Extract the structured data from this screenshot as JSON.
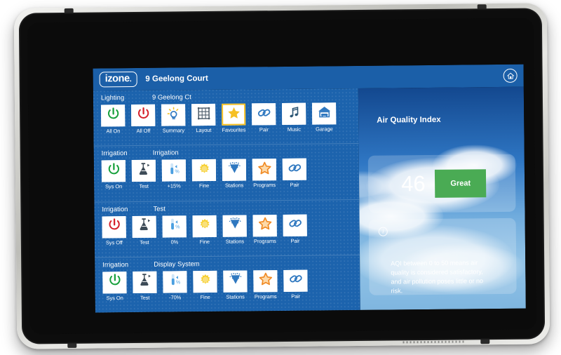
{
  "header": {
    "logo_text": "izone",
    "logo_dot": ".",
    "title": "9 Geelong Court",
    "home_icon": "home-circle-icon"
  },
  "rows": [
    {
      "type": "Lighting",
      "name": "9 Geelong Ct",
      "tiles": [
        {
          "label": "All On",
          "icon": "power-icon",
          "color": "#17a03c",
          "selected": false
        },
        {
          "label": "All Off",
          "icon": "power-icon",
          "color": "#d5202a",
          "selected": false
        },
        {
          "label": "Summary",
          "icon": "lightbulb-icon",
          "color": "#2f78c0",
          "selected": false
        },
        {
          "label": "Layout",
          "icon": "grid-icon",
          "color": "#4a5a68",
          "selected": false
        },
        {
          "label": "Favourites",
          "icon": "star-icon",
          "color": "#f6c024",
          "selected": true
        },
        {
          "label": "Pair",
          "icon": "link-icon",
          "color": "#2f78c0",
          "selected": false
        },
        {
          "label": "Music",
          "icon": "music-note-icon",
          "color": "#2b5574",
          "selected": false
        },
        {
          "label": "Garage",
          "icon": "garage-icon",
          "color": "#2f78c0",
          "selected": false
        }
      ]
    },
    {
      "type": "Irrigation",
      "name": "Irrigation",
      "tiles": [
        {
          "label": "Sys On",
          "icon": "power-icon",
          "color": "#17a03c",
          "selected": false
        },
        {
          "label": "Test",
          "icon": "flask-play-icon",
          "color": "#3d4b57",
          "selected": false
        },
        {
          "label": "+15%",
          "icon": "test-tube-percent-icon",
          "color": "#4a9fe0",
          "selected": false
        },
        {
          "label": "Fine",
          "icon": "sun-icon",
          "color": "#f7cf2e",
          "selected": false
        },
        {
          "label": "Stations",
          "icon": "sprinkler-icon",
          "color": "#2f78c0",
          "selected": false
        },
        {
          "label": "Programs",
          "icon": "star-outline-icon",
          "color": "#f08a24",
          "selected": false
        },
        {
          "label": "Pair",
          "icon": "link-icon",
          "color": "#2f78c0",
          "selected": false
        }
      ]
    },
    {
      "type": "Irrigation",
      "name": "Test",
      "tiles": [
        {
          "label": "Sys Off",
          "icon": "power-icon",
          "color": "#d5202a",
          "selected": false
        },
        {
          "label": "Test",
          "icon": "flask-play-icon",
          "color": "#3d4b57",
          "selected": false
        },
        {
          "label": "0%",
          "icon": "test-tube-percent-icon",
          "color": "#4a9fe0",
          "selected": false
        },
        {
          "label": "Fine",
          "icon": "sun-icon",
          "color": "#f7cf2e",
          "selected": false
        },
        {
          "label": "Stations",
          "icon": "sprinkler-icon",
          "color": "#2f78c0",
          "selected": false
        },
        {
          "label": "Programs",
          "icon": "star-outline-icon",
          "color": "#f08a24",
          "selected": false
        },
        {
          "label": "Pair",
          "icon": "link-icon",
          "color": "#2f78c0",
          "selected": false
        }
      ]
    },
    {
      "type": "Irrigation",
      "name": "Display System",
      "tiles": [
        {
          "label": "Sys On",
          "icon": "power-icon",
          "color": "#17a03c",
          "selected": false
        },
        {
          "label": "Test",
          "icon": "flask-play-icon",
          "color": "#3d4b57",
          "selected": false
        },
        {
          "label": "-70%",
          "icon": "test-tube-percent-icon",
          "color": "#4a9fe0",
          "selected": false
        },
        {
          "label": "Fine",
          "icon": "sun-icon",
          "color": "#f7cf2e",
          "selected": false
        },
        {
          "label": "Stations",
          "icon": "sprinkler-icon",
          "color": "#2f78c0",
          "selected": false
        },
        {
          "label": "Programs",
          "icon": "star-outline-icon",
          "color": "#f08a24",
          "selected": false
        },
        {
          "label": "Pair",
          "icon": "link-icon",
          "color": "#2f78c0",
          "selected": false
        }
      ]
    }
  ],
  "aqi": {
    "title": "Air Quality Index",
    "value": "46",
    "rating": "Great",
    "rating_color": "#4aab54",
    "info_icon": "info-icon",
    "info_text": "AQI between 0 to 50 means air quality is considered satisfactory, and air pollution poses little or no risk."
  }
}
